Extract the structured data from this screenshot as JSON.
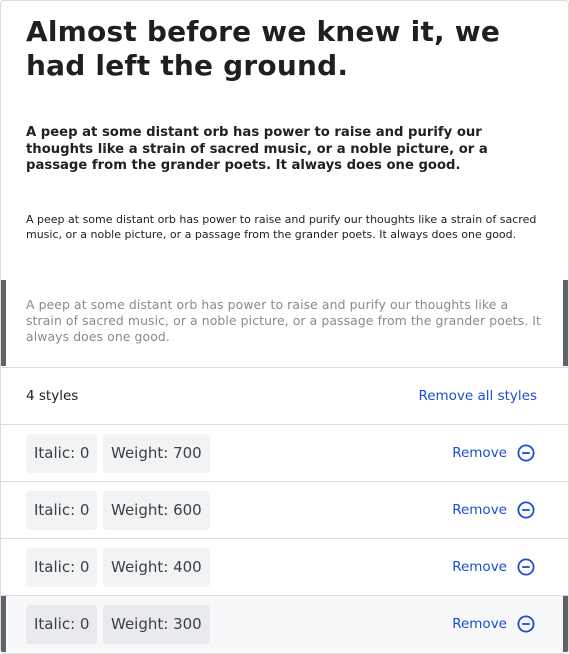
{
  "preview": {
    "headline": "Almost before we knew it, we had left the ground.",
    "paragraph_bold": "A peep at some distant orb has power to raise and purify our thoughts like a strain of sacred music, or a noble picture, or a passage from the grander poets. It always does one good.",
    "paragraph_regular": "A peep at some distant orb has power to raise and purify our thoughts like a strain of sacred music, or a noble picture, or a passage from the grander poets. It always does one good.",
    "paragraph_light": "A peep at some distant orb has power to raise and purify our thoughts like a strain of sacred music, or a noble picture, or a passage from the grander poets. It always does one good."
  },
  "summary": {
    "count_label": "4 styles",
    "remove_all_label": "Remove all styles"
  },
  "styles": [
    {
      "italic": "Italic: 0",
      "weight": "Weight: 700",
      "remove_label": "Remove",
      "active": false
    },
    {
      "italic": "Italic: 0",
      "weight": "Weight: 600",
      "remove_label": "Remove",
      "active": false
    },
    {
      "italic": "Italic: 0",
      "weight": "Weight: 400",
      "remove_label": "Remove",
      "active": false
    },
    {
      "italic": "Italic: 0",
      "weight": "Weight: 300",
      "remove_label": "Remove",
      "active": true
    }
  ],
  "colors": {
    "accent": "#1a4fd1",
    "active_bar": "#5f6368",
    "chip_bg": "#f1f3f4",
    "divider": "#dadce0"
  },
  "icons": {
    "remove": "remove-circle-icon"
  }
}
